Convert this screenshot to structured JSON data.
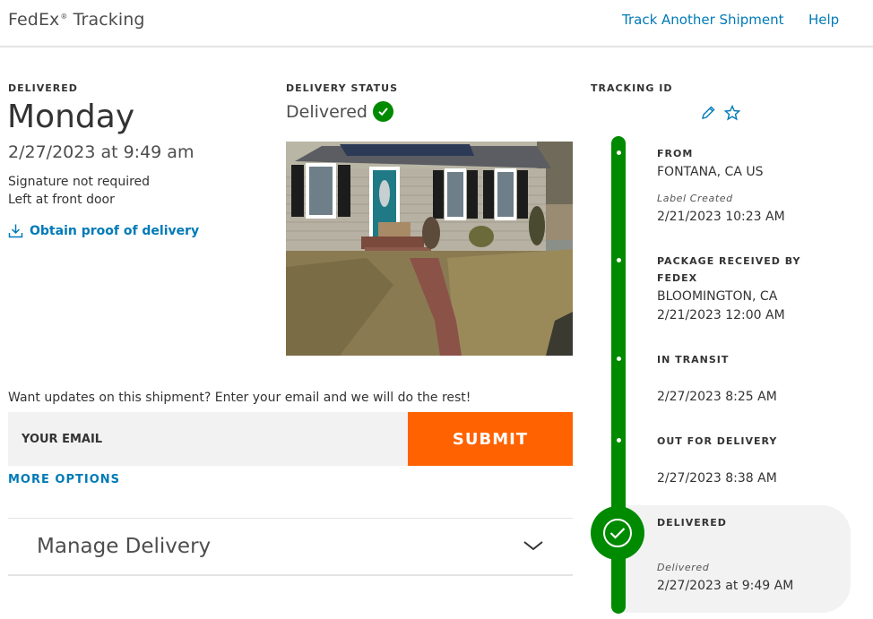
{
  "header": {
    "brand": "FedEx",
    "brand_mark": "®",
    "brand_suffix": " Tracking",
    "nav": {
      "track_another": "Track Another Shipment",
      "help": "Help"
    }
  },
  "summary": {
    "label": "DELIVERED",
    "day": "Monday",
    "datetime": "2/27/2023 at 9:49 am",
    "signature": "Signature not required",
    "left_at": "Left at front door",
    "proof_link": "Obtain proof of delivery"
  },
  "status": {
    "label": "DELIVERY STATUS",
    "value": "Delivered"
  },
  "email": {
    "prompt": "Want updates on this shipment? Enter your email and we will do the rest!",
    "placeholder": "YOUR EMAIL",
    "submit": "SUBMIT",
    "more_options": "MORE OPTIONS"
  },
  "manage": {
    "title": "Manage Delivery"
  },
  "tracking": {
    "label": "TRACKING ID",
    "events": [
      {
        "title": "FROM",
        "line1": "FONTANA, CA US",
        "note": "Label Created",
        "line2": "2/21/2023 10:23 AM"
      },
      {
        "title": "PACKAGE RECEIVED BY FEDEX",
        "line1": "BLOOMINGTON, CA",
        "line2": "2/21/2023 12:00 AM"
      },
      {
        "title": "IN TRANSIT",
        "line2": "2/27/2023 8:25 AM"
      },
      {
        "title": "OUT FOR DELIVERY",
        "line2": "2/27/2023 8:38 AM"
      },
      {
        "title": "DELIVERED",
        "note": "Delivered",
        "line2": "2/27/2023 at 9:49 AM"
      }
    ]
  },
  "colors": {
    "brand_blue": "#007ab7",
    "submit_orange": "#ff6200",
    "status_green": "#008a00"
  },
  "icons": [
    "download-icon",
    "check-circle-icon",
    "pencil-icon",
    "star-icon",
    "chevron-down-icon",
    "delivered-check-icon"
  ]
}
